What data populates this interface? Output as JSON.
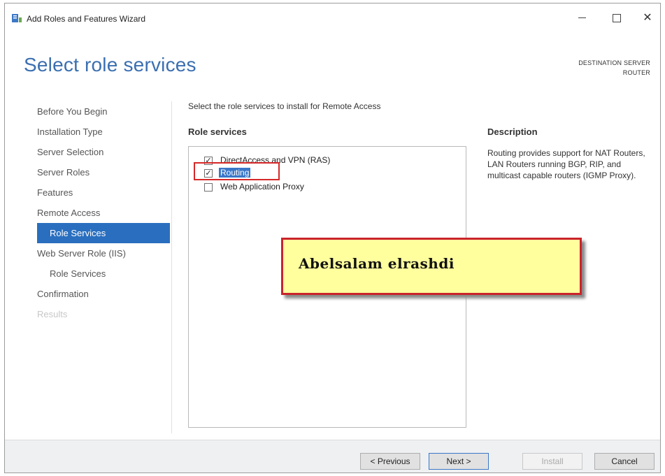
{
  "window": {
    "title": "Add Roles and Features Wizard"
  },
  "header": {
    "page_title": "Select role services",
    "destination_label": "DESTINATION SERVER",
    "destination_value": "ROUTER"
  },
  "nav": {
    "items": [
      {
        "label": "Before You Begin",
        "state": "normal"
      },
      {
        "label": "Installation Type",
        "state": "normal"
      },
      {
        "label": "Server Selection",
        "state": "normal"
      },
      {
        "label": "Server Roles",
        "state": "normal"
      },
      {
        "label": "Features",
        "state": "normal"
      },
      {
        "label": "Remote Access",
        "state": "normal"
      },
      {
        "label": "Role Services",
        "state": "active"
      },
      {
        "label": "Web Server Role (IIS)",
        "state": "normal"
      },
      {
        "label": "Role Services",
        "state": "sub"
      },
      {
        "label": "Confirmation",
        "state": "normal"
      },
      {
        "label": "Results",
        "state": "disabled"
      }
    ]
  },
  "main": {
    "instruction": "Select the role services to install for Remote Access",
    "role_services_heading": "Role services",
    "role_services": [
      {
        "label": "DirectAccess and VPN (RAS)",
        "checked": true
      },
      {
        "label": "Routing",
        "checked": true
      },
      {
        "label": "Web Application Proxy",
        "checked": false
      }
    ],
    "description_heading": "Description",
    "description_text": "Routing provides support for NAT Routers, LAN Routers running BGP, RIP, and multicast capable routers (IGMP Proxy)."
  },
  "overlay": {
    "text": "Abelsalam elrashdi"
  },
  "footer": {
    "previous": "< Previous",
    "next": "Next >",
    "install": "Install",
    "cancel": "Cancel"
  },
  "colors": {
    "accent": "#3b6fb0",
    "nav_active": "#2a6fbf",
    "highlight_border": "#d62828",
    "banner_fill": "#ffff9e"
  }
}
